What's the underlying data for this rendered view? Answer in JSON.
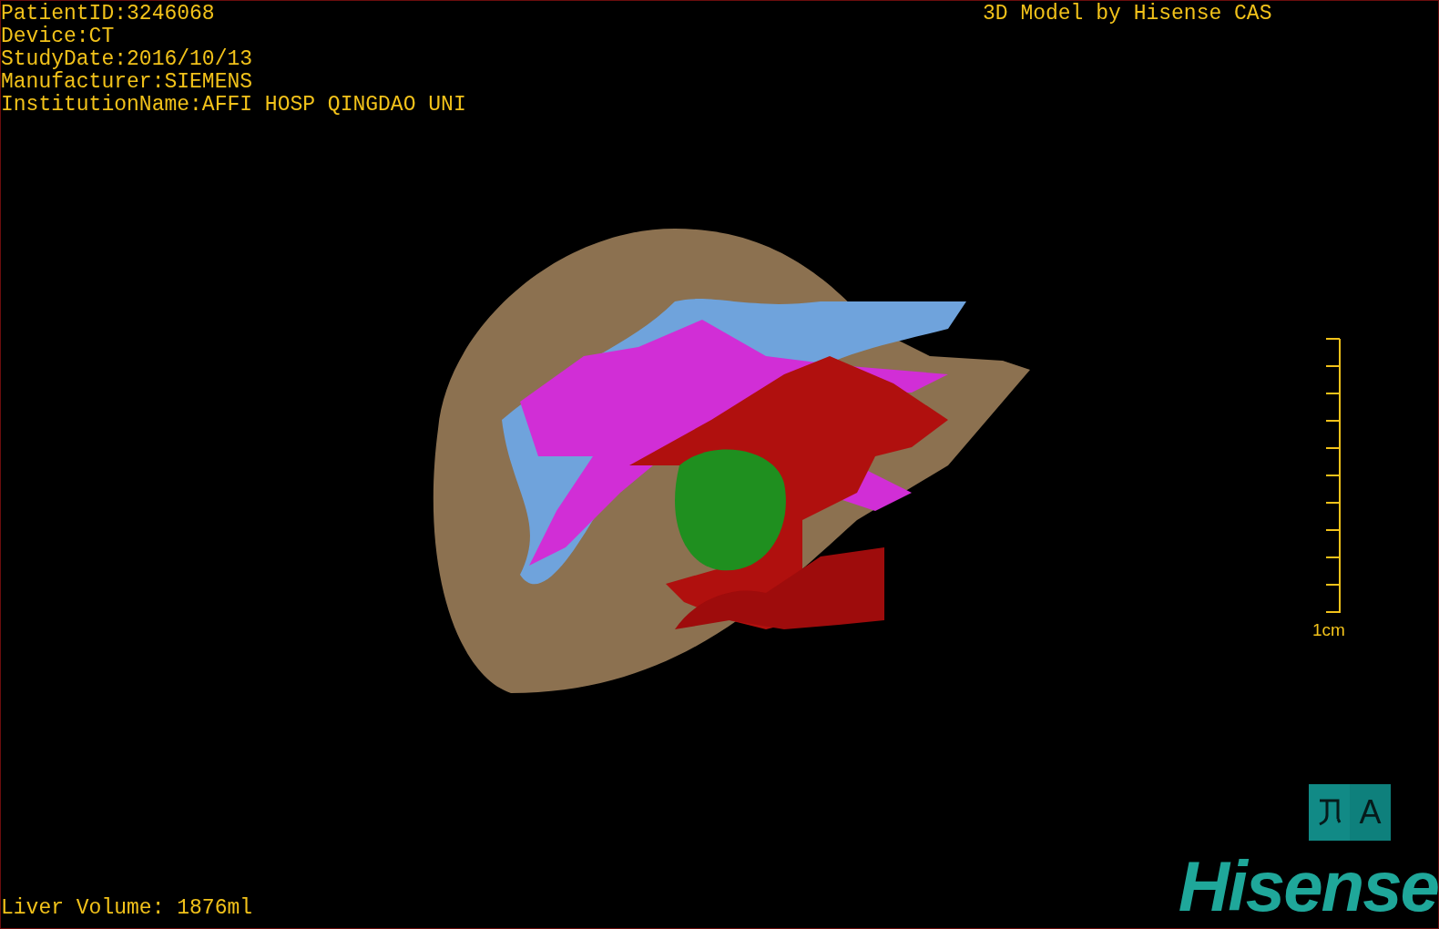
{
  "patient_info": [
    "PatientID:3246068",
    "Device:CT",
    "StudyDate:2016/10/13",
    "Manufacturer:SIEMENS",
    "InstitutionName:AFFI HOSP QINGDAO UNI"
  ],
  "credit": "3D Model by Hisense CAS",
  "scale_bar": {
    "label": "1cm"
  },
  "orientation_cube": {
    "label": "A"
  },
  "measurement": "Liver Volume: 1876ml",
  "logo": "Hisense"
}
